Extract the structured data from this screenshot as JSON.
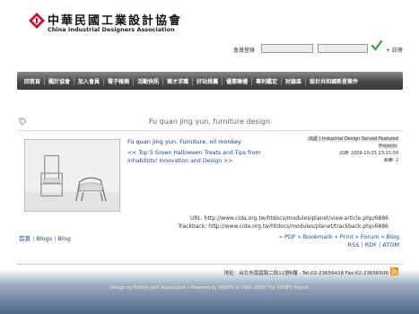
{
  "header": {
    "logo_zh": "中華民國工業設計協會",
    "logo_en": "China Industrial Designers Association",
    "login_label": "會員登錄",
    "register_label": "+ 註冊"
  },
  "nav": {
    "items": [
      "回首頁",
      "關於協會",
      "加入會員",
      "電子報摘",
      "活動快訊",
      "徵才求職",
      "好站推薦",
      "優惠聯播",
      "專利鑑定",
      "討論區",
      "設計共和國新星徵件"
    ]
  },
  "title": "Fu quan jing yun, furniture design",
  "article": {
    "headline": "Fu quan jing yun, Furniture, oil monkey",
    "nav_text": "<< Top 5 Green Halloween Treats and Tips from Inhabitots! Innovation and Design >>"
  },
  "meta": {
    "source_label": "出處 |",
    "source_value": "Industrial Design Served Featured Projects",
    "date_label": "日期:",
    "date_value": "2009-10-25 23:15:09",
    "hits_label": "點擊:",
    "hits_value": "2"
  },
  "links": {
    "url_label": "URL:",
    "url_value": "http://www.cida.org.tw/htdocs/modules/planet/view.article.php/6886",
    "trackback_label": "Trackback:",
    "trackback_value": "http://www.cida.org.tw/htdocs/modules/planet/trackback.php/6886"
  },
  "breadcrumb": {
    "home": "首頁",
    "sep": "|",
    "blogs": "Blogs",
    "blog": "Blog"
  },
  "actions": {
    "pdf": "» PDF",
    "bookmark": "» Bookmark",
    "print": "» Print",
    "forum": "» Forum",
    "blog": "» Blog"
  },
  "feeds": {
    "rss": "RSS",
    "rdf": "RDF",
    "atom": "ATOM",
    "sep": "|"
  },
  "footer": {
    "address": "地址：台北市南昌路二段11號6樓 ‧ Tel:02-23656418 Fax:02-23656506",
    "credits": "Design by Edition and XoopsLand  •  Powered by XOOPS © 2001-2009 The XOOPS Project"
  }
}
